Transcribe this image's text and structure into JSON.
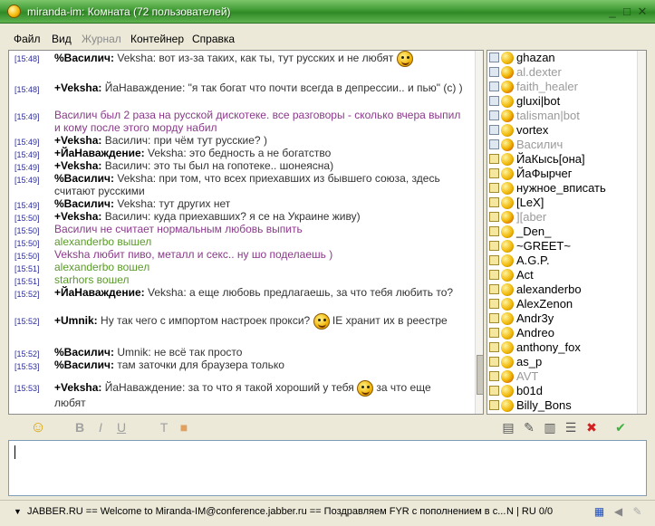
{
  "window": {
    "title": "miranda-im: Комната (72 пользователей)"
  },
  "menu": [
    {
      "label": "Файл",
      "disabled": false
    },
    {
      "label": "Вид",
      "disabled": false
    },
    {
      "label": "Журнал",
      "disabled": true
    },
    {
      "label": "Контейнер",
      "disabled": false
    },
    {
      "label": "Справка",
      "disabled": false
    }
  ],
  "messages": [
    {
      "time": "[15:48]",
      "nick": "%Василич:",
      "text": "Veksha: вот из-за таких, как ты, тут русских и не любят",
      "emoticon": true,
      "style": "normal"
    },
    {
      "time": "[15:48]",
      "nick": "+Veksha:",
      "text": "ЙаНаваждение: \"я так богат что почти всегда в депрессии.. и пью\" (с)  )",
      "style": "normal"
    },
    {
      "time": "[15:49]",
      "nick": "",
      "text": "Василич  был 2 раза на русской дискотеке. все разговоры - сколько вчера выпил и кому после этого морду набил",
      "style": "action"
    },
    {
      "time": "[15:49]",
      "nick": "+Veksha:",
      "text": "Василич: при чём тут русские? )",
      "style": "normal"
    },
    {
      "time": "[15:49]",
      "nick": "+ЙаНаваждение:",
      "text": "Veksha: это бедность а не богатство",
      "style": "normal"
    },
    {
      "time": "[15:49]",
      "nick": "+Veksha:",
      "text": "Василич: это ты был на гопотеке.. шонеясна)",
      "style": "normal"
    },
    {
      "time": "[15:49]",
      "nick": "%Василич:",
      "text": "Veksha: при том, что всех приехавших из бывшего союза, здесь считают русскими",
      "style": "normal"
    },
    {
      "time": "[15:49]",
      "nick": "%Василич:",
      "text": "Veksha: тут других нет",
      "style": "normal"
    },
    {
      "time": "[15:50]",
      "nick": "+Veksha:",
      "text": "Василич: куда приехавших?  я се на Украине живу)",
      "style": "normal"
    },
    {
      "time": "[15:50]",
      "nick": "",
      "text": "Василич  не считает нормальным любовь выпить",
      "style": "action"
    },
    {
      "time": "[15:50]",
      "nick": "",
      "text": "alexanderbo вышел",
      "style": "event"
    },
    {
      "time": "[15:50]",
      "nick": "",
      "text": "Veksha любит пиво, металл и секс.. ну шо поделаешь )",
      "style": "action"
    },
    {
      "time": "[15:51]",
      "nick": "",
      "text": "alexanderbo вошел",
      "style": "event"
    },
    {
      "time": "[15:51]",
      "nick": "",
      "text": "starhors вошел",
      "style": "event"
    },
    {
      "time": "[15:52]",
      "nick": "+ЙаНаваждение:",
      "text": "Veksha: а еще любовь предлагаешь, за что тебя любить то?",
      "style": "normal"
    },
    {
      "time": "[15:52]",
      "nick": "+Umnik:",
      "text": "Ну так чего с импортом настроек прокси?",
      "text2": "IE хранит их в реестре",
      "emoticon": true,
      "style": "normal"
    },
    {
      "time": "[15:52]",
      "nick": "%Василич:",
      "text": "Umnik: не всё так просто",
      "style": "normal"
    },
    {
      "time": "[15:53]",
      "nick": "%Василич:",
      "text": "там заточки для браузера только",
      "style": "normal"
    },
    {
      "time": "[15:53]",
      "nick": "+Veksha:",
      "text": "ЙаНаваждение: за то что я такой хороший у тебя",
      "text2": "за что еще любят",
      "emoticon": true,
      "style": "normal"
    }
  ],
  "users": [
    {
      "name": "ghazan",
      "level": "n",
      "status": "online"
    },
    {
      "name": "al.dexter",
      "level": "n",
      "status": "offline"
    },
    {
      "name": "faith_healer",
      "level": "n",
      "status": "offline"
    },
    {
      "name": "gluxi|bot",
      "level": "n",
      "status": "online"
    },
    {
      "name": "talisman|bot",
      "level": "n",
      "status": "offline"
    },
    {
      "name": "vortex",
      "level": "n",
      "status": "online"
    },
    {
      "name": "Василич",
      "level": "n",
      "status": "offline"
    },
    {
      "name": "ЙаКысь[она]",
      "level": "v",
      "status": "online"
    },
    {
      "name": "ЙаФырчег",
      "level": "v",
      "status": "online"
    },
    {
      "name": "нужное_вписать",
      "level": "v",
      "status": "online"
    },
    {
      "name": "[LeX]",
      "level": "v",
      "status": "online"
    },
    {
      "name": "][aber",
      "level": "v",
      "status": "offline"
    },
    {
      "name": "_Den_",
      "level": "v",
      "status": "online"
    },
    {
      "name": "~GREET~",
      "level": "v",
      "status": "online"
    },
    {
      "name": "A.G.P.",
      "level": "v",
      "status": "online"
    },
    {
      "name": "Act",
      "level": "v",
      "status": "online"
    },
    {
      "name": "alexanderbo",
      "level": "v",
      "status": "online"
    },
    {
      "name": "AlexZenon",
      "level": "v",
      "status": "online"
    },
    {
      "name": "Andr3y",
      "level": "v",
      "status": "online"
    },
    {
      "name": "Andreo",
      "level": "v",
      "status": "online"
    },
    {
      "name": "anthony_fox",
      "level": "v",
      "status": "online"
    },
    {
      "name": "as_p",
      "level": "v",
      "status": "online"
    },
    {
      "name": "AVT",
      "level": "v",
      "status": "offline"
    },
    {
      "name": "b01d",
      "level": "v",
      "status": "online"
    },
    {
      "name": "Billy_Bons",
      "level": "v",
      "status": "online"
    }
  ],
  "toolbar": {
    "left": [
      "smiley-icon",
      "bold-icon",
      "italic-icon",
      "underline-icon",
      "text-color-icon",
      "bg-color-icon"
    ],
    "right": [
      "history-icon",
      "filter-icon",
      "topic-icon",
      "nicklist-icon",
      "close-icon",
      "send-icon"
    ]
  },
  "status": {
    "text": "JABBER.RU == Welcome to Miranda-IM@conference.jabber.ru ==  Поздравляем FYR с пополнением в с...",
    "mode": "N | RU 0/0"
  },
  "colors": {
    "title_bar": "#3f9a34",
    "timestamp": "#2b2ba0",
    "action": "#8a3a8a",
    "event": "#5a9a2a",
    "close_red": "#d02020",
    "send_green": "#40b040"
  }
}
